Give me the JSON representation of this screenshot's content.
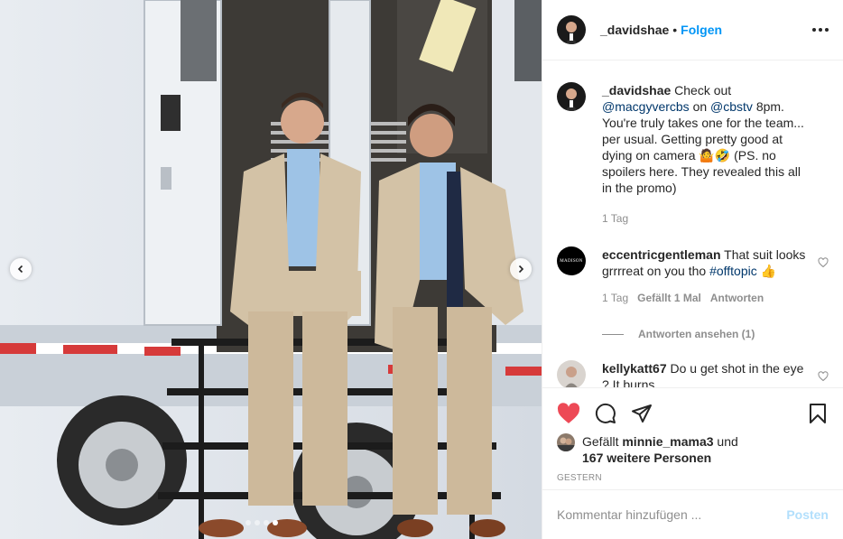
{
  "post": {
    "username": "_davidshae",
    "separator": "•",
    "follow_label": "Folgen",
    "more_icon": "more-horizontal-icon"
  },
  "caption": {
    "username": "_davidshae",
    "text_1": " Check out ",
    "mention_1": "@macgyvercbs",
    "text_2": " on ",
    "mention_2": "@cbstv",
    "text_3": " 8pm. You're truly takes one for the team... per usual. Getting pretty good at dying on camera 🤷🤣 (PS. no spoilers here. They revealed this all in the promo)",
    "time": "1 Tag"
  },
  "comments": [
    {
      "username": "eccentricgentleman",
      "text": " That suit looks grrrreat on you tho ",
      "hashtag": "#offtopic",
      "emoji": " 👍",
      "avatar_text": "MADISON",
      "time": "1 Tag",
      "likes": "Gefällt 1 Mal",
      "reply_label": "Antworten",
      "view_replies": "Antworten ansehen (1)"
    },
    {
      "username": "kellykatt67",
      "text": " Do u get shot in the eye ? It burns"
    }
  ],
  "likes": {
    "prefix": "Gefällt ",
    "user": "minnie_mama3",
    "mid": " und",
    "others": "167 weitere Personen"
  },
  "date_label": "GESTERN",
  "add_comment": {
    "placeholder": "Kommentar hinzufügen ...",
    "post_label": "Posten"
  },
  "colors": {
    "accent": "#0095f6",
    "heart": "#ed4956",
    "text": "#262626",
    "muted": "#8e8e8e"
  },
  "carousel": {
    "slide_count": 4,
    "active_index": 3
  }
}
